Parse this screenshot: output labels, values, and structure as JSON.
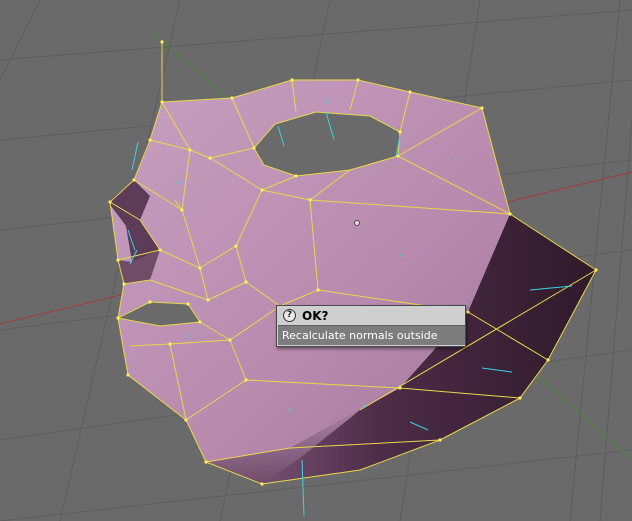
{
  "popup": {
    "title": "OK?",
    "option_label": "Recalculate normals outside",
    "icon": "question-icon"
  },
  "colors": {
    "background": "#6a6a6a",
    "grid": "#5a5a5a",
    "x_axis": "#a03c3c",
    "y_axis": "#4a8a3c",
    "mesh_light": "#c99dc0",
    "mesh_dark": "#3d2238",
    "edge_selected": "#e8d84a",
    "normal_line": "#3cd2e6",
    "popup_bg": "#cfcfcf",
    "popup_highlight": "#7d7d7d"
  }
}
